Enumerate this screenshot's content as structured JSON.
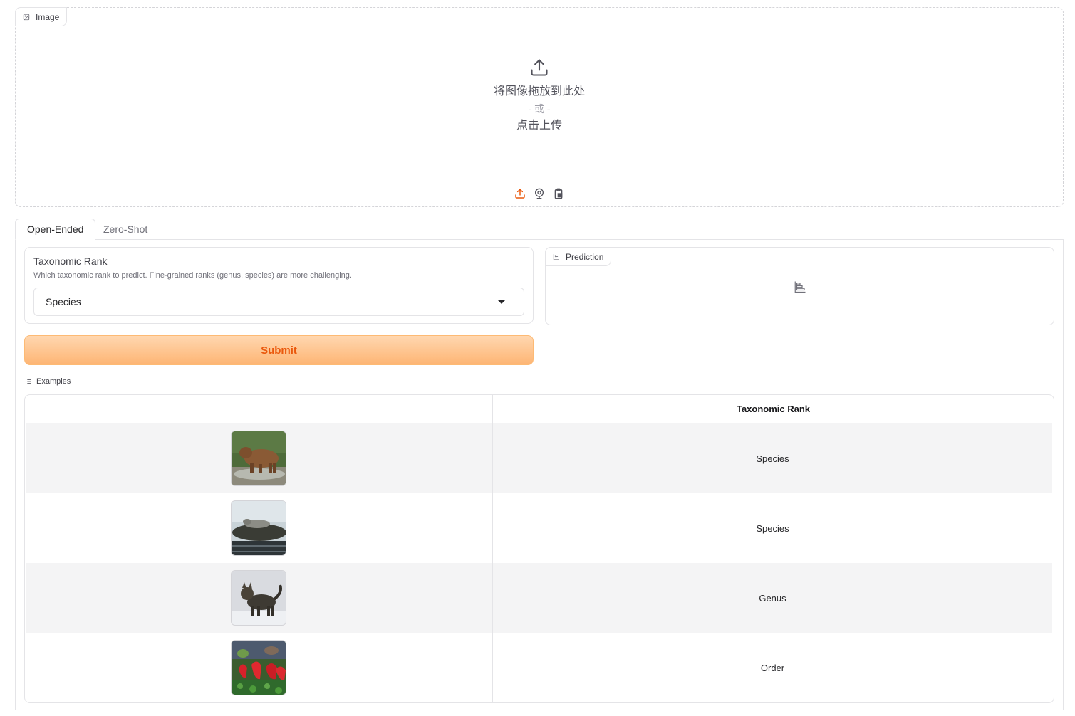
{
  "image_input": {
    "label": "Image",
    "drop_text": "将图像拖放到此处",
    "or_text": "- 或 -",
    "click_text": "点击上传",
    "sources": [
      "upload-icon",
      "webcam-icon",
      "clipboard-icon"
    ]
  },
  "tabs": [
    {
      "label": "Open-Ended",
      "active": true
    },
    {
      "label": "Zero-Shot",
      "active": false
    }
  ],
  "rank_dropdown": {
    "label": "Taxonomic Rank",
    "info": "Which taxonomic rank to predict. Fine-grained ranks (genus, species) are more challenging.",
    "value": "Species"
  },
  "prediction": {
    "label": "Prediction"
  },
  "submit": {
    "label": "Submit"
  },
  "examples": {
    "label": "Examples",
    "header": {
      "col1": "",
      "col2": "Taxonomic Rank"
    },
    "rows": [
      {
        "image": "bear",
        "rank": "Species"
      },
      {
        "image": "seal",
        "rank": "Species"
      },
      {
        "image": "cat",
        "rank": "Genus"
      },
      {
        "image": "red-fungi",
        "rank": "Order"
      }
    ]
  },
  "colors": {
    "accent": "#ea580c",
    "button_gradient_top": "#ffd7b0",
    "button_gradient_bottom": "#fdb574",
    "border": "#e4e4e7"
  }
}
